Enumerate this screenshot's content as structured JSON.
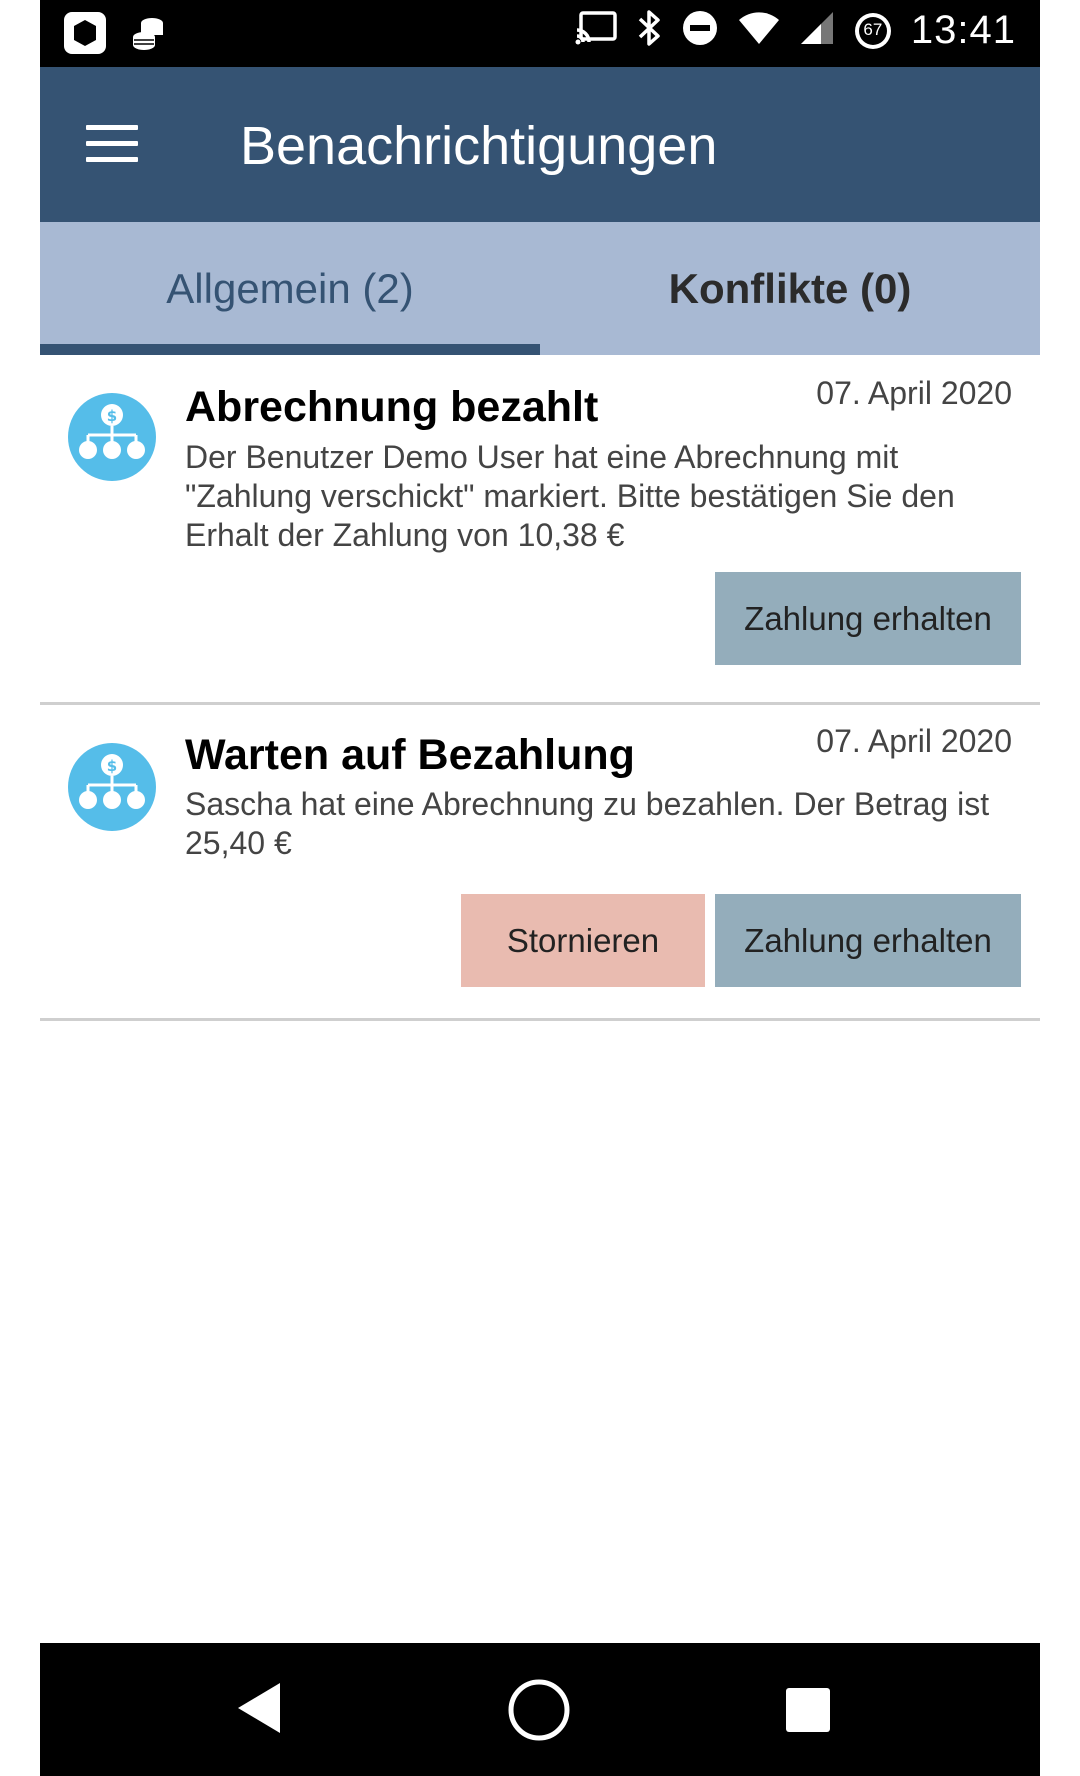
{
  "status_bar": {
    "time": "13:41",
    "battery_level": "67",
    "icons": [
      "app-icon",
      "coins-icon",
      "cast-icon",
      "bluetooth-icon",
      "do-not-disturb-icon",
      "wifi-icon",
      "cell-signal-icon",
      "battery-icon"
    ]
  },
  "app_bar": {
    "title": "Benachrichtigungen",
    "menu_icon": "hamburger-menu-icon"
  },
  "tabs": [
    {
      "label": "Allgemein (2)",
      "active": true
    },
    {
      "label": "Konflikte (0)",
      "active": false
    }
  ],
  "notifications": [
    {
      "title": "Abrechnung bezahlt",
      "date": "07. April 2020",
      "body": "Der Benutzer Demo User hat eine Abrechnung mit \"Zahlung verschickt\" markiert. Bitte bestätigen Sie den Erhalt der Zahlung von 10,38 €",
      "icon": "payment-hierarchy-icon",
      "actions": [
        {
          "label": "Zahlung erhalten",
          "style": "primary"
        }
      ]
    },
    {
      "title": "Warten auf Bezahlung",
      "date": "07. April 2020",
      "body": "Sascha hat eine Abrechnung zu bezahlen. Der Betrag ist 25,40 €",
      "icon": "payment-hierarchy-icon",
      "actions": [
        {
          "label": "Stornieren",
          "style": "danger"
        },
        {
          "label": "Zahlung erhalten",
          "style": "primary"
        }
      ]
    }
  ],
  "nav_bar": {
    "icons": [
      "back-icon",
      "home-icon",
      "recents-icon"
    ]
  },
  "colors": {
    "app_bar": "#355373",
    "tab_bar": "#a8b9d3",
    "avatar": "#55bde9",
    "primary_button": "#94adbb",
    "danger_button": "#e9bbb0"
  }
}
